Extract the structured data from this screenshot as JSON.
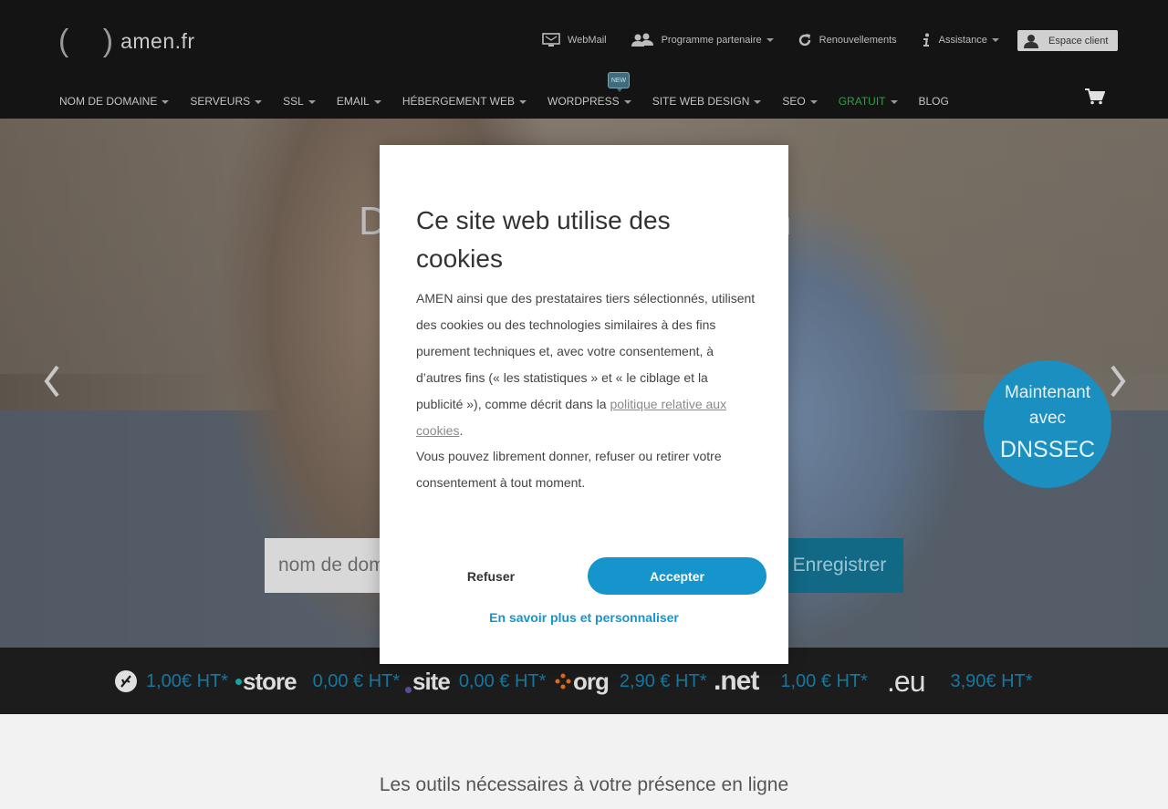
{
  "logo": {
    "parens": "( )",
    "text": "amen.fr"
  },
  "topnav": {
    "webmail": "WebMail",
    "partner": "Programme partenaire",
    "renewals": "Renouvellements",
    "support": "Assistance",
    "client": "Espace client"
  },
  "mainnav": [
    {
      "label": "NOM DE DOMAINE",
      "dropdown": true
    },
    {
      "label": "SERVEURS",
      "dropdown": true
    },
    {
      "label": "SSL",
      "dropdown": true
    },
    {
      "label": "EMAIL",
      "dropdown": true
    },
    {
      "label": "HÉBERGEMENT WEB",
      "dropdown": true
    },
    {
      "label": "WORDPRESS",
      "dropdown": true
    },
    {
      "label": "SITE WEB DESIGN",
      "dropdown": true
    },
    {
      "label": "SEO",
      "dropdown": true
    },
    {
      "label": "GRATUIT",
      "dropdown": true
    },
    {
      "label": "BLOG",
      "dropdown": false
    }
  ],
  "badge_new": "NEW",
  "hero": {
    "title_start": "D",
    "title_end": "n",
    "dnssec_line1": "Maintenant",
    "dnssec_line2": "avec",
    "dnssec_line3": "DNSSEC",
    "search_placeholder": "nom de domaine",
    "search_visible": "nom de dor",
    "register_label": "Enregistrer"
  },
  "tlds": [
    {
      "name": ".fr",
      "price": "1,00€ HT*"
    },
    {
      "name": "store",
      "price": "0,00 € HT*"
    },
    {
      "name": "site",
      "price": "0,00 € HT*"
    },
    {
      "name": "org",
      "price": "2,90 € HT*"
    },
    {
      "name": ".net",
      "price": "1,00 € HT*"
    },
    {
      "name": ".eu",
      "price": "3,90€ HT*"
    }
  ],
  "bottom_title": "Les outils nécessaires à votre présence en ligne",
  "cookie_modal": {
    "title": "Ce site web utilise des cookies",
    "body_part1": "AMEN ainsi que des prestataires tiers sélectionnés, utilisent des cookies ou des technologies similaires à des fins purement techniques et, avec votre consentement, à d’autres fins (« les statistiques » et « le ciblage et la publicité »), comme décrit dans la ",
    "body_link": "politique relative aux cookies",
    "body_part2": ".",
    "body_part3": "Vous pouvez librement donner, refuser ou retirer votre consentement à tout moment.",
    "refuse": "Refuser",
    "accept": "Accepter",
    "more": "En savoir plus et personnaliser"
  },
  "colors": {
    "header_bg": "#141414",
    "accent_blue": "#1695cd",
    "gratuit_green": "#2ea043",
    "dnssec_blue": "#1a8fc0"
  }
}
